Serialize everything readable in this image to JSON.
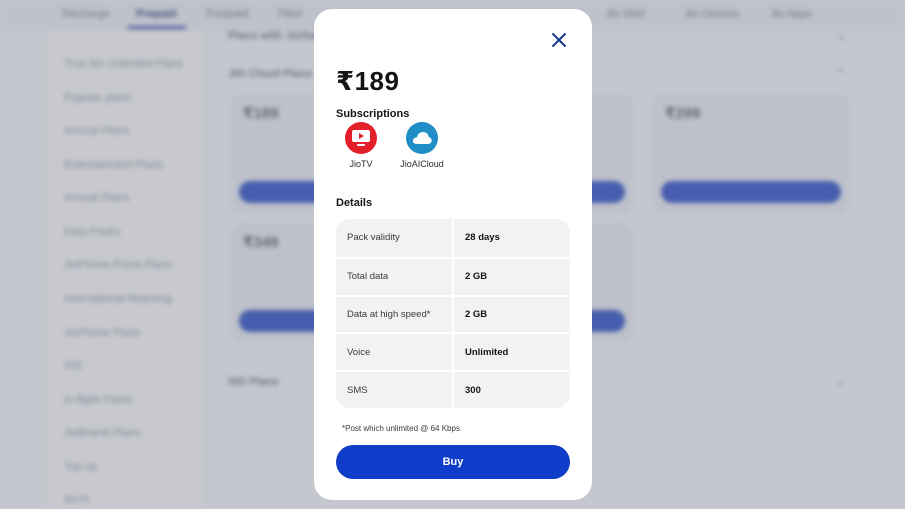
{
  "background": {
    "nav_items": [
      "Recharge",
      "Prepaid",
      "Postpaid",
      "Fiber",
      "",
      "",
      "Jio Mart",
      "Jio Cinema",
      "Jio Apps"
    ],
    "sidebar_items": [
      "True 5G Unlimited Plans",
      "Popular plans",
      "Annual Plans",
      "Entertainment Plans",
      "Annual Plans",
      "Data Packs",
      "JioPhone Prima Plans",
      "International Roaming",
      "JioPhone Plans",
      "ISD",
      "In-flight Packs",
      "JioBharat Plans",
      "Top-up",
      "Wi-Fi"
    ],
    "section_rows": [
      "Plans with JioSaavn",
      "JIO Cloud Plans",
      "ISD Plans"
    ],
    "card_prices": [
      "₹189",
      "₹299",
      "₹349"
    ]
  },
  "modal": {
    "price": "₹189",
    "subscriptions_title": "Subscriptions",
    "subscriptions": [
      {
        "name": "JioTV",
        "icon": "jiotv-icon",
        "color": "#e3202a"
      },
      {
        "name": "JioAICloud",
        "icon": "jioaicloud-icon",
        "color": "#1f8ec6"
      }
    ],
    "details_title": "Details",
    "details": [
      {
        "label": "Pack validity",
        "value": "28 days"
      },
      {
        "label": "Total data",
        "value": "2 GB"
      },
      {
        "label": "Data at high speed*",
        "value": "2 GB"
      },
      {
        "label": "Voice",
        "value": "Unlimited"
      },
      {
        "label": "SMS",
        "value": "300"
      }
    ],
    "footnote": "*Post which unlimited @ 64 Kbps",
    "buy_label": "Buy",
    "colors": {
      "buy": "#0f3cc9",
      "close": "#1a3a8f"
    }
  }
}
